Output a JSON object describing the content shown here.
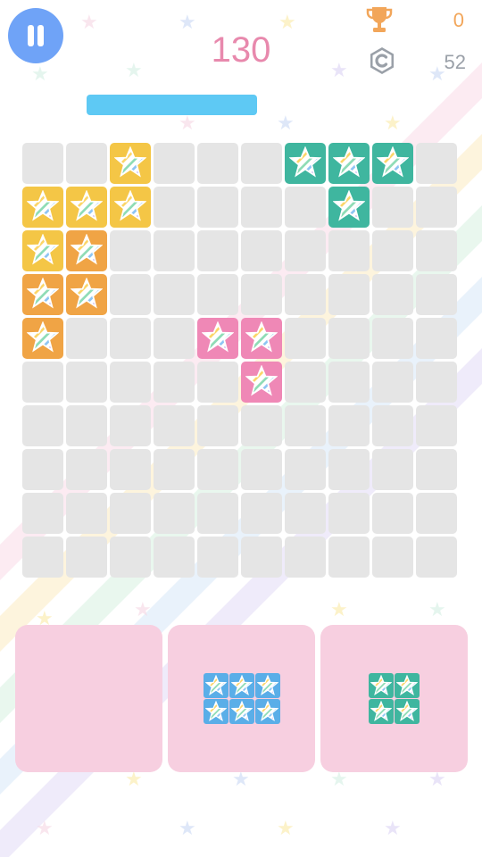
{
  "score": "130",
  "best_score": "0",
  "coins": "52",
  "level_progress": 0.64,
  "colors": {
    "yellow": "#f4c646",
    "orange": "#f0a445",
    "teal": "#3fb69f",
    "pink": "#ef88b6",
    "blue": "#5aaee8",
    "empty": "#e5e5e5",
    "tray": "#f7cfe0",
    "accent_blue": "#6fa3f7",
    "progress": "#5ec9f4"
  },
  "board": {
    "size": 10,
    "rows": [
      [
        ".",
        ".",
        "yellow",
        ".",
        ".",
        ".",
        "teal",
        "teal",
        "teal",
        "."
      ],
      [
        "yellow",
        "yellow",
        "yellow",
        ".",
        ".",
        ".",
        ".",
        "teal",
        ".",
        "."
      ],
      [
        "yellow",
        "orange",
        ".",
        ".",
        ".",
        ".",
        ".",
        ".",
        ".",
        "."
      ],
      [
        "orange",
        "orange",
        ".",
        ".",
        ".",
        ".",
        ".",
        ".",
        ".",
        "."
      ],
      [
        "orange",
        ".",
        ".",
        ".",
        "pink",
        "pink",
        ".",
        ".",
        ".",
        "."
      ],
      [
        ".",
        ".",
        ".",
        ".",
        ".",
        "pink",
        ".",
        ".",
        ".",
        "."
      ],
      [
        ".",
        ".",
        ".",
        ".",
        ".",
        ".",
        ".",
        ".",
        ".",
        "."
      ],
      [
        ".",
        ".",
        ".",
        ".",
        ".",
        ".",
        ".",
        ".",
        ".",
        "."
      ],
      [
        ".",
        ".",
        ".",
        ".",
        ".",
        ".",
        ".",
        ".",
        ".",
        "."
      ],
      [
        ".",
        ".",
        ".",
        ".",
        ".",
        ".",
        ".",
        ".",
        ".",
        "."
      ]
    ]
  },
  "trays": [
    {
      "name": "tray-empty",
      "piece": null
    },
    {
      "name": "tray-blue-piece",
      "piece": {
        "color": "blue",
        "cols": 3,
        "rows": 2
      }
    },
    {
      "name": "tray-teal-piece",
      "piece": {
        "color": "teal",
        "cols": 2,
        "rows": 2
      }
    }
  ],
  "icons": {
    "pause": "pause-icon",
    "trophy": "trophy-icon",
    "coin": "copyright-coin-icon",
    "block": "rainbow-star-icon"
  }
}
